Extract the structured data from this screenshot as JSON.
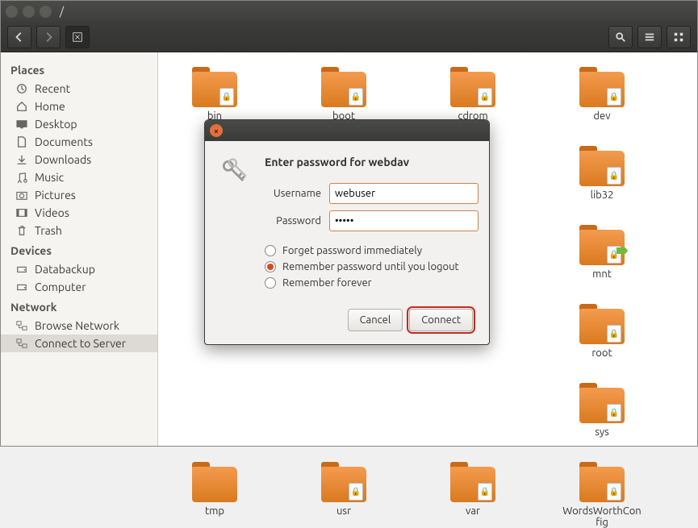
{
  "window": {
    "path": "/"
  },
  "sidebar": {
    "places_heading": "Places",
    "places": [
      {
        "label": "Recent",
        "icon": "clock-icon"
      },
      {
        "label": "Home",
        "icon": "home-icon"
      },
      {
        "label": "Desktop",
        "icon": "desktop-icon"
      },
      {
        "label": "Documents",
        "icon": "document-icon"
      },
      {
        "label": "Downloads",
        "icon": "download-icon"
      },
      {
        "label": "Music",
        "icon": "music-icon"
      },
      {
        "label": "Pictures",
        "icon": "camera-icon"
      },
      {
        "label": "Videos",
        "icon": "video-icon"
      },
      {
        "label": "Trash",
        "icon": "trash-icon"
      }
    ],
    "devices_heading": "Devices",
    "devices": [
      {
        "label": "Databackup",
        "icon": "drive-icon"
      },
      {
        "label": "Computer",
        "icon": "drive-icon"
      }
    ],
    "network_heading": "Network",
    "network": [
      {
        "label": "Browse Network",
        "icon": "network-icon"
      },
      {
        "label": "Connect to Server",
        "icon": "network-icon",
        "selected": true
      }
    ]
  },
  "files": {
    "row1": [
      "bin",
      "boot",
      "cdrom",
      "dev"
    ],
    "item_lib32": "lib32",
    "item_mnt": "mnt",
    "item_root": "root",
    "item_sys": "sys",
    "row5": [
      "tmp",
      "usr",
      "var",
      "WordsWorthConfig"
    ]
  },
  "dialog": {
    "heading": "Enter password for webdav",
    "username_label": "Username",
    "username_value": "webuser",
    "password_label": "Password",
    "password_value": "•••••",
    "radio_forget": "Forget password immediately",
    "radio_logout": "Remember password until you logout",
    "radio_forever": "Remember forever",
    "selected_option": "logout",
    "cancel_label": "Cancel",
    "connect_label": "Connect"
  }
}
